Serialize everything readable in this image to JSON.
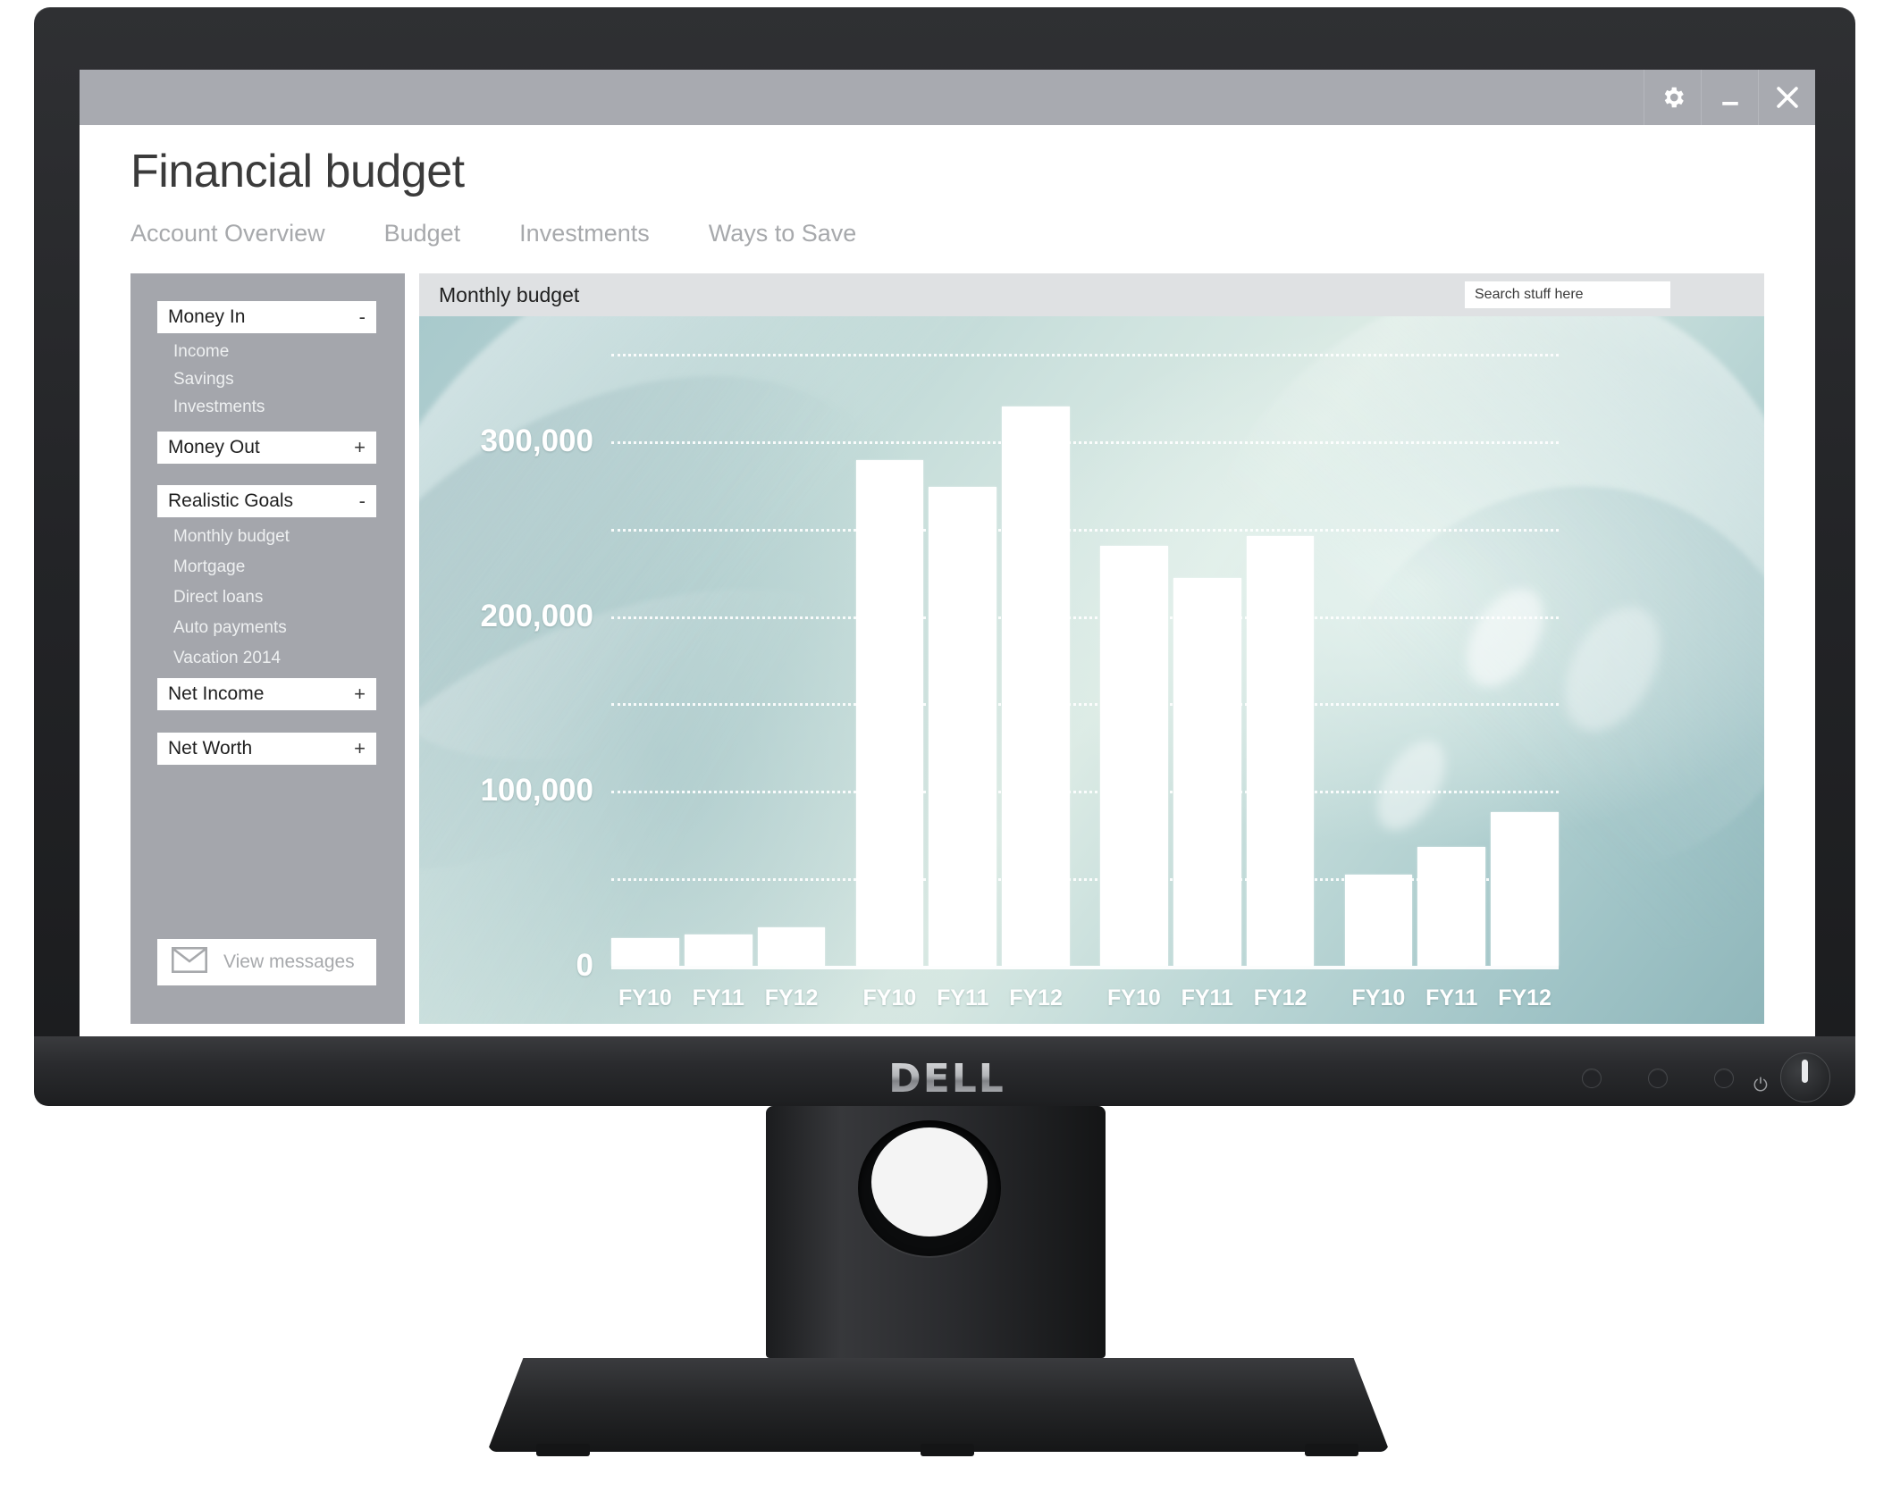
{
  "window": {
    "controls": [
      {
        "name": "settings",
        "icon": "gear-icon",
        "label": "Settings"
      },
      {
        "name": "minimize",
        "icon": "minimize-icon",
        "label": "Minimize"
      },
      {
        "name": "close",
        "icon": "close-icon",
        "label": "Close"
      }
    ]
  },
  "header": {
    "title": "Financial budget",
    "nav": [
      {
        "label": "Account Overview"
      },
      {
        "label": "Budget"
      },
      {
        "label": "Investments"
      },
      {
        "label": "Ways to Save"
      }
    ]
  },
  "sidebar": {
    "groups": [
      {
        "label": "Money In",
        "toggle": "-",
        "items": [
          {
            "label": "Income"
          },
          {
            "label": "Savings"
          },
          {
            "label": "Investments"
          }
        ]
      },
      {
        "label": "Money Out",
        "toggle": "+",
        "items": []
      },
      {
        "label": "Realistic Goals",
        "toggle": "-",
        "items": [
          {
            "label": "Monthly budget"
          },
          {
            "label": "Mortgage"
          },
          {
            "label": "Direct loans"
          },
          {
            "label": "Auto payments"
          },
          {
            "label": "Vacation 2014"
          }
        ]
      },
      {
        "label": "Net Income",
        "toggle": "+",
        "items": []
      },
      {
        "label": "Net Worth",
        "toggle": "+",
        "items": []
      }
    ],
    "messages_button": {
      "label": "View messages",
      "icon": "envelope-icon"
    }
  },
  "content": {
    "title": "Monthly budget",
    "search": {
      "placeholder": "Search stuff here",
      "value": ""
    }
  },
  "colors": {
    "titlebar": "#a8aab0",
    "sidebar": "#a4a6ac",
    "content_head": "#dfe1e3",
    "nav_text": "#a7a9ac",
    "bar_fill": "#ffffff",
    "chart_bg_teal": "#b7d3d2"
  },
  "chart_data": {
    "type": "bar",
    "title": "Monthly budget",
    "xlabel": "",
    "ylabel": "",
    "ylim": [
      0,
      350000
    ],
    "grid": true,
    "grid_interval": 50000,
    "legend": "none",
    "tick_labels_y": [
      "0",
      "100,000",
      "200,000",
      "300,000"
    ],
    "tick_values_y": [
      0,
      100000,
      200000,
      300000
    ],
    "categories": [
      "FY10",
      "FY11",
      "FY12",
      "FY10",
      "FY11",
      "FY12",
      "FY10",
      "FY11",
      "FY12",
      "FY10",
      "FY11",
      "FY12"
    ],
    "group_count": 4,
    "values": [
      16000,
      18000,
      22000,
      289000,
      274000,
      320000,
      240000,
      222000,
      246000,
      52000,
      68000,
      88000
    ]
  }
}
